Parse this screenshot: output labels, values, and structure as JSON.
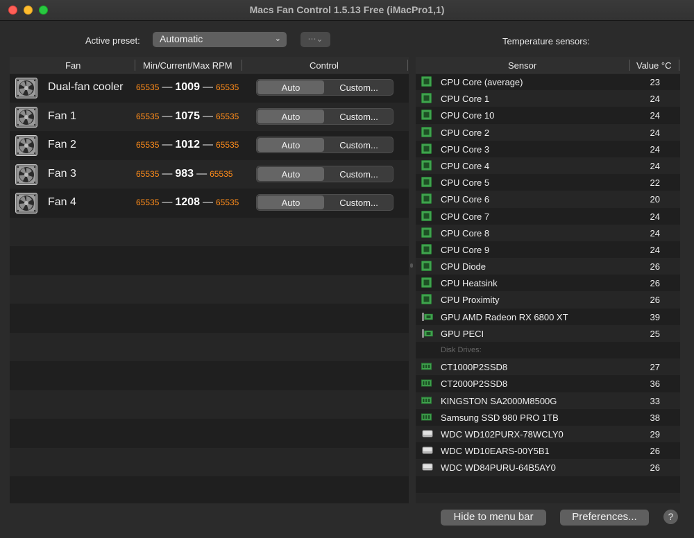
{
  "window": {
    "title": "Macs Fan Control 1.5.13 Free (iMacPro1,1)"
  },
  "preset": {
    "label": "Active preset:",
    "value": "Automatic",
    "options_icon": "ellipsis-circle-icon"
  },
  "sensors_title": "Temperature sensors:",
  "fan_table": {
    "columns": [
      "Fan",
      "Min/Current/Max RPM",
      "Control"
    ],
    "rows": [
      {
        "name": "Dual-fan cooler",
        "min": "65535",
        "current": "1009",
        "max": "65535",
        "mode_auto": "Auto",
        "mode_custom": "Custom..."
      },
      {
        "name": "Fan 1",
        "min": "65535",
        "current": "1075",
        "max": "65535",
        "mode_auto": "Auto",
        "mode_custom": "Custom..."
      },
      {
        "name": "Fan 2",
        "min": "65535",
        "current": "1012",
        "max": "65535",
        "mode_auto": "Auto",
        "mode_custom": "Custom..."
      },
      {
        "name": "Fan 3",
        "min": "65535",
        "current": "983",
        "max": "65535",
        "mode_auto": "Auto",
        "mode_custom": "Custom..."
      },
      {
        "name": "Fan 4",
        "min": "65535",
        "current": "1208",
        "max": "65535",
        "mode_auto": "Auto",
        "mode_custom": "Custom..."
      }
    ],
    "dash": "—"
  },
  "sensor_table": {
    "columns": [
      "Sensor",
      "Value °C"
    ],
    "rows": [
      {
        "kind": "cpu",
        "name": "CPU Core (average)",
        "value": "23"
      },
      {
        "kind": "cpu",
        "name": "CPU Core 1",
        "value": "24"
      },
      {
        "kind": "cpu",
        "name": "CPU Core 10",
        "value": "24"
      },
      {
        "kind": "cpu",
        "name": "CPU Core 2",
        "value": "24"
      },
      {
        "kind": "cpu",
        "name": "CPU Core 3",
        "value": "24"
      },
      {
        "kind": "cpu",
        "name": "CPU Core 4",
        "value": "24"
      },
      {
        "kind": "cpu",
        "name": "CPU Core 5",
        "value": "22"
      },
      {
        "kind": "cpu",
        "name": "CPU Core 6",
        "value": "20"
      },
      {
        "kind": "cpu",
        "name": "CPU Core 7",
        "value": "24"
      },
      {
        "kind": "cpu",
        "name": "CPU Core 8",
        "value": "24"
      },
      {
        "kind": "cpu",
        "name": "CPU Core 9",
        "value": "24"
      },
      {
        "kind": "cpu",
        "name": "CPU Diode",
        "value": "26"
      },
      {
        "kind": "cpu",
        "name": "CPU Heatsink",
        "value": "26"
      },
      {
        "kind": "cpu",
        "name": "CPU Proximity",
        "value": "26"
      },
      {
        "kind": "gpu",
        "name": "GPU AMD Radeon RX 6800 XT",
        "value": "39"
      },
      {
        "kind": "gpu",
        "name": "GPU PECI",
        "value": "25"
      },
      {
        "kind": "group",
        "name": "Disk Drives:",
        "value": ""
      },
      {
        "kind": "ssd",
        "name": "CT1000P2SSD8",
        "value": "27"
      },
      {
        "kind": "ssd",
        "name": "CT2000P2SSD8",
        "value": "36"
      },
      {
        "kind": "ssd",
        "name": "KINGSTON SA2000M8500G",
        "value": "33"
      },
      {
        "kind": "ssd",
        "name": "Samsung SSD 980 PRO 1TB",
        "value": "38"
      },
      {
        "kind": "hdd",
        "name": "WDC WD102PURX-78WCLY0",
        "value": "29"
      },
      {
        "kind": "hdd",
        "name": "WDC WD10EARS-00Y5B1",
        "value": "26"
      },
      {
        "kind": "hdd",
        "name": "WDC WD84PURU-64B5AY0",
        "value": "26"
      }
    ]
  },
  "buttons": {
    "hide": "Hide to menu bar",
    "preferences": "Preferences...",
    "help": "?"
  },
  "colors": {
    "rpm_limit": "#ff8c1a",
    "chip_green": "#3fa34d",
    "background": "#2b2b2b"
  }
}
